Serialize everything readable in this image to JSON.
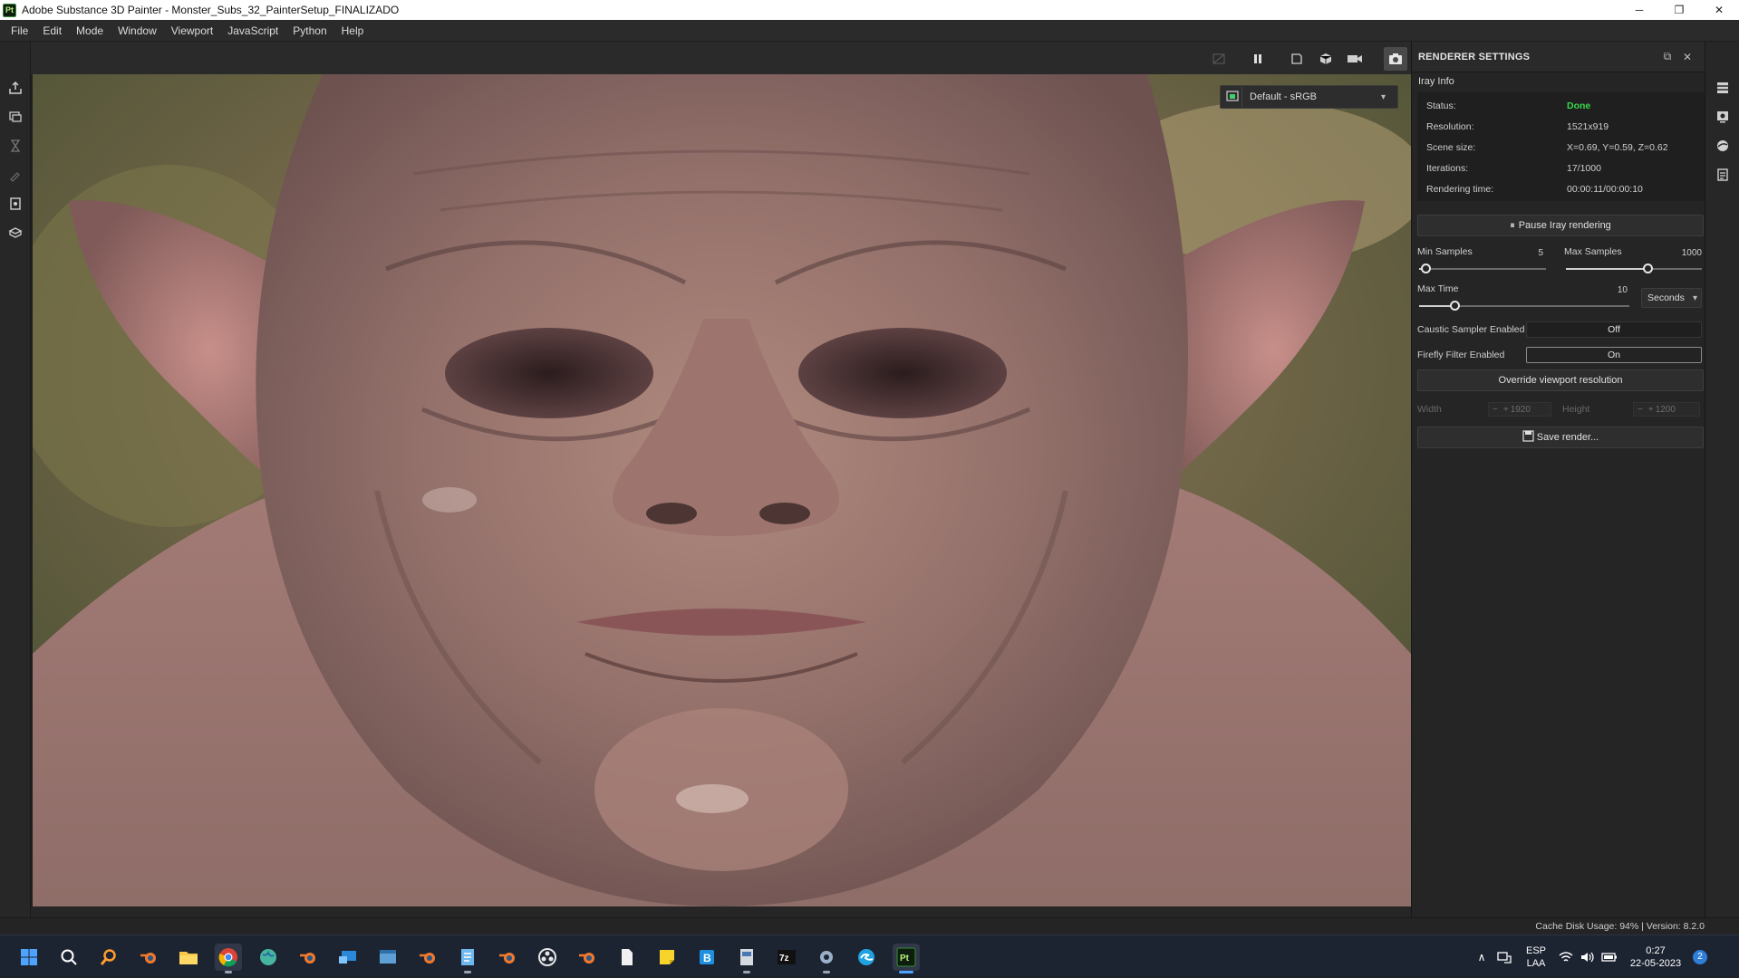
{
  "window": {
    "title": "Adobe Substance 3D Painter - Monster_Subs_32_PainterSetup_FINALIZADO",
    "app_badge": "Pt",
    "minimize": "─",
    "maximize": "❐",
    "close": "✕"
  },
  "menu": [
    "File",
    "Edit",
    "Mode",
    "Window",
    "Viewport",
    "JavaScript",
    "Python",
    "Help"
  ],
  "viewport": {
    "colorspace": "Default - sRGB",
    "toolbar_icons": [
      "no-display-icon",
      "pause-icon",
      "2d-view-icon",
      "3d-cube-icon",
      "camera-icon",
      "screenshot-icon"
    ]
  },
  "renderer_settings": {
    "title": "RENDERER SETTINGS",
    "section": "Iray Info",
    "info": [
      {
        "label": "Status:",
        "value": "Done"
      },
      {
        "label": "Resolution:",
        "value": "1521x919"
      },
      {
        "label": "Scene size:",
        "value": "X=0.69, Y=0.59, Z=0.62"
      },
      {
        "label": "Iterations:",
        "value": "17/1000"
      },
      {
        "label": "Rendering time:",
        "value": "00:00:11/00:00:10"
      }
    ],
    "pause_button": "Pause Iray rendering",
    "min_samples": {
      "label": "Min Samples",
      "value": "5",
      "fraction": 0.05
    },
    "max_samples": {
      "label": "Max Samples",
      "value": "1000",
      "fraction": 0.6
    },
    "max_time": {
      "label": "Max Time",
      "value": "10",
      "fraction": 0.17,
      "unit": "Seconds"
    },
    "caustic": {
      "label": "Caustic Sampler Enabled",
      "value": "Off"
    },
    "firefly": {
      "label": "Firefly Filter Enabled",
      "value": "On"
    },
    "override_button": "Override viewport resolution",
    "width": {
      "label": "Width",
      "value": "1920"
    },
    "height": {
      "label": "Height",
      "value": "1200"
    },
    "save_button": "Save render..."
  },
  "status_bar": {
    "text": "Cache Disk Usage:    94% | Version: 8.2.0"
  },
  "taskbar": {
    "language": "ESP",
    "layout": "LAA",
    "time": "0:27",
    "date": "22-05-2023",
    "notifications": "2"
  },
  "colors": {
    "accent_green": "#39d84b",
    "taskbar_bg": "#1d2431",
    "panel_bg": "#252525"
  }
}
